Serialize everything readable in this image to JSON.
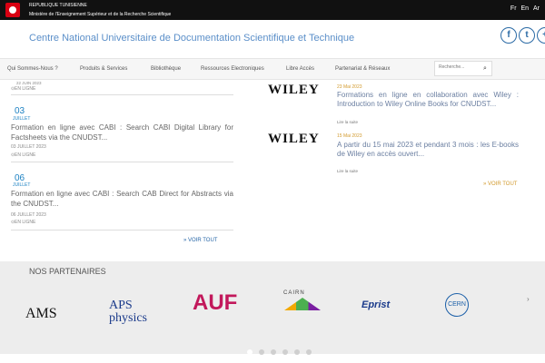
{
  "topbar": {
    "country": "REPUBLIQUE TUNISIENNE",
    "ministry": "Ministère de l'Enseignement Supérieur et de la Recherche Scientifique",
    "languages": [
      "Fr",
      "En",
      "Ar"
    ]
  },
  "header": {
    "title": "Centre National Universitaire de Documentation Scientifique et Technique",
    "social": [
      "f",
      "t",
      "+"
    ]
  },
  "nav": {
    "items": [
      "Qui Sommes-Nous ?",
      "Produits & Services",
      "Bibliothèque",
      "Ressources Electroniques",
      "Libre Accès",
      "Partenariat & Réseaux"
    ],
    "search_placeholder": "Recherche..."
  },
  "news_left": [
    {
      "day": "",
      "month": "",
      "title": "",
      "date": "22 JUIN 2023",
      "location": "EN LIGNE"
    },
    {
      "day": "03",
      "month": "JUILLET",
      "title": "Formation en ligne avec CABI : Search CABI Digital Library for Factsheets via the CNUDST...",
      "date": "03 JUILLET 2023",
      "location": "EN LIGNE"
    },
    {
      "day": "06",
      "month": "JUILLET",
      "title": "Formation en ligne avec CABI : Search CAB Direct for Abstracts via the CNUDST...",
      "date": "06 JUILLET 2023",
      "location": "EN LIGNE"
    }
  ],
  "news_right": [
    {
      "logo": "WILEY",
      "date": "23 Mai 2023",
      "title": "Formations en ligne en collaboration avec Wiley : Introduction to Wiley Online Books for CNUDST...",
      "read_more": "Lire la suite"
    },
    {
      "logo": "WILEY",
      "date": "15 Mai 2023",
      "title": "A partir du 15 mai 2023 et pendant 3 mois : les E-books de Wiley en accès ouvert...",
      "read_more": "Lire la suite"
    }
  ],
  "more_labels": {
    "left": "» VOIR TOUT",
    "right": "» VOIR TOUT"
  },
  "partners": {
    "title": "NOS PARTENAIRES",
    "logos": [
      "AMS",
      "APS physics",
      "AUF",
      "CAIRN",
      "Eprist",
      "CERN"
    ],
    "dots": 6,
    "active_dot": 0
  }
}
